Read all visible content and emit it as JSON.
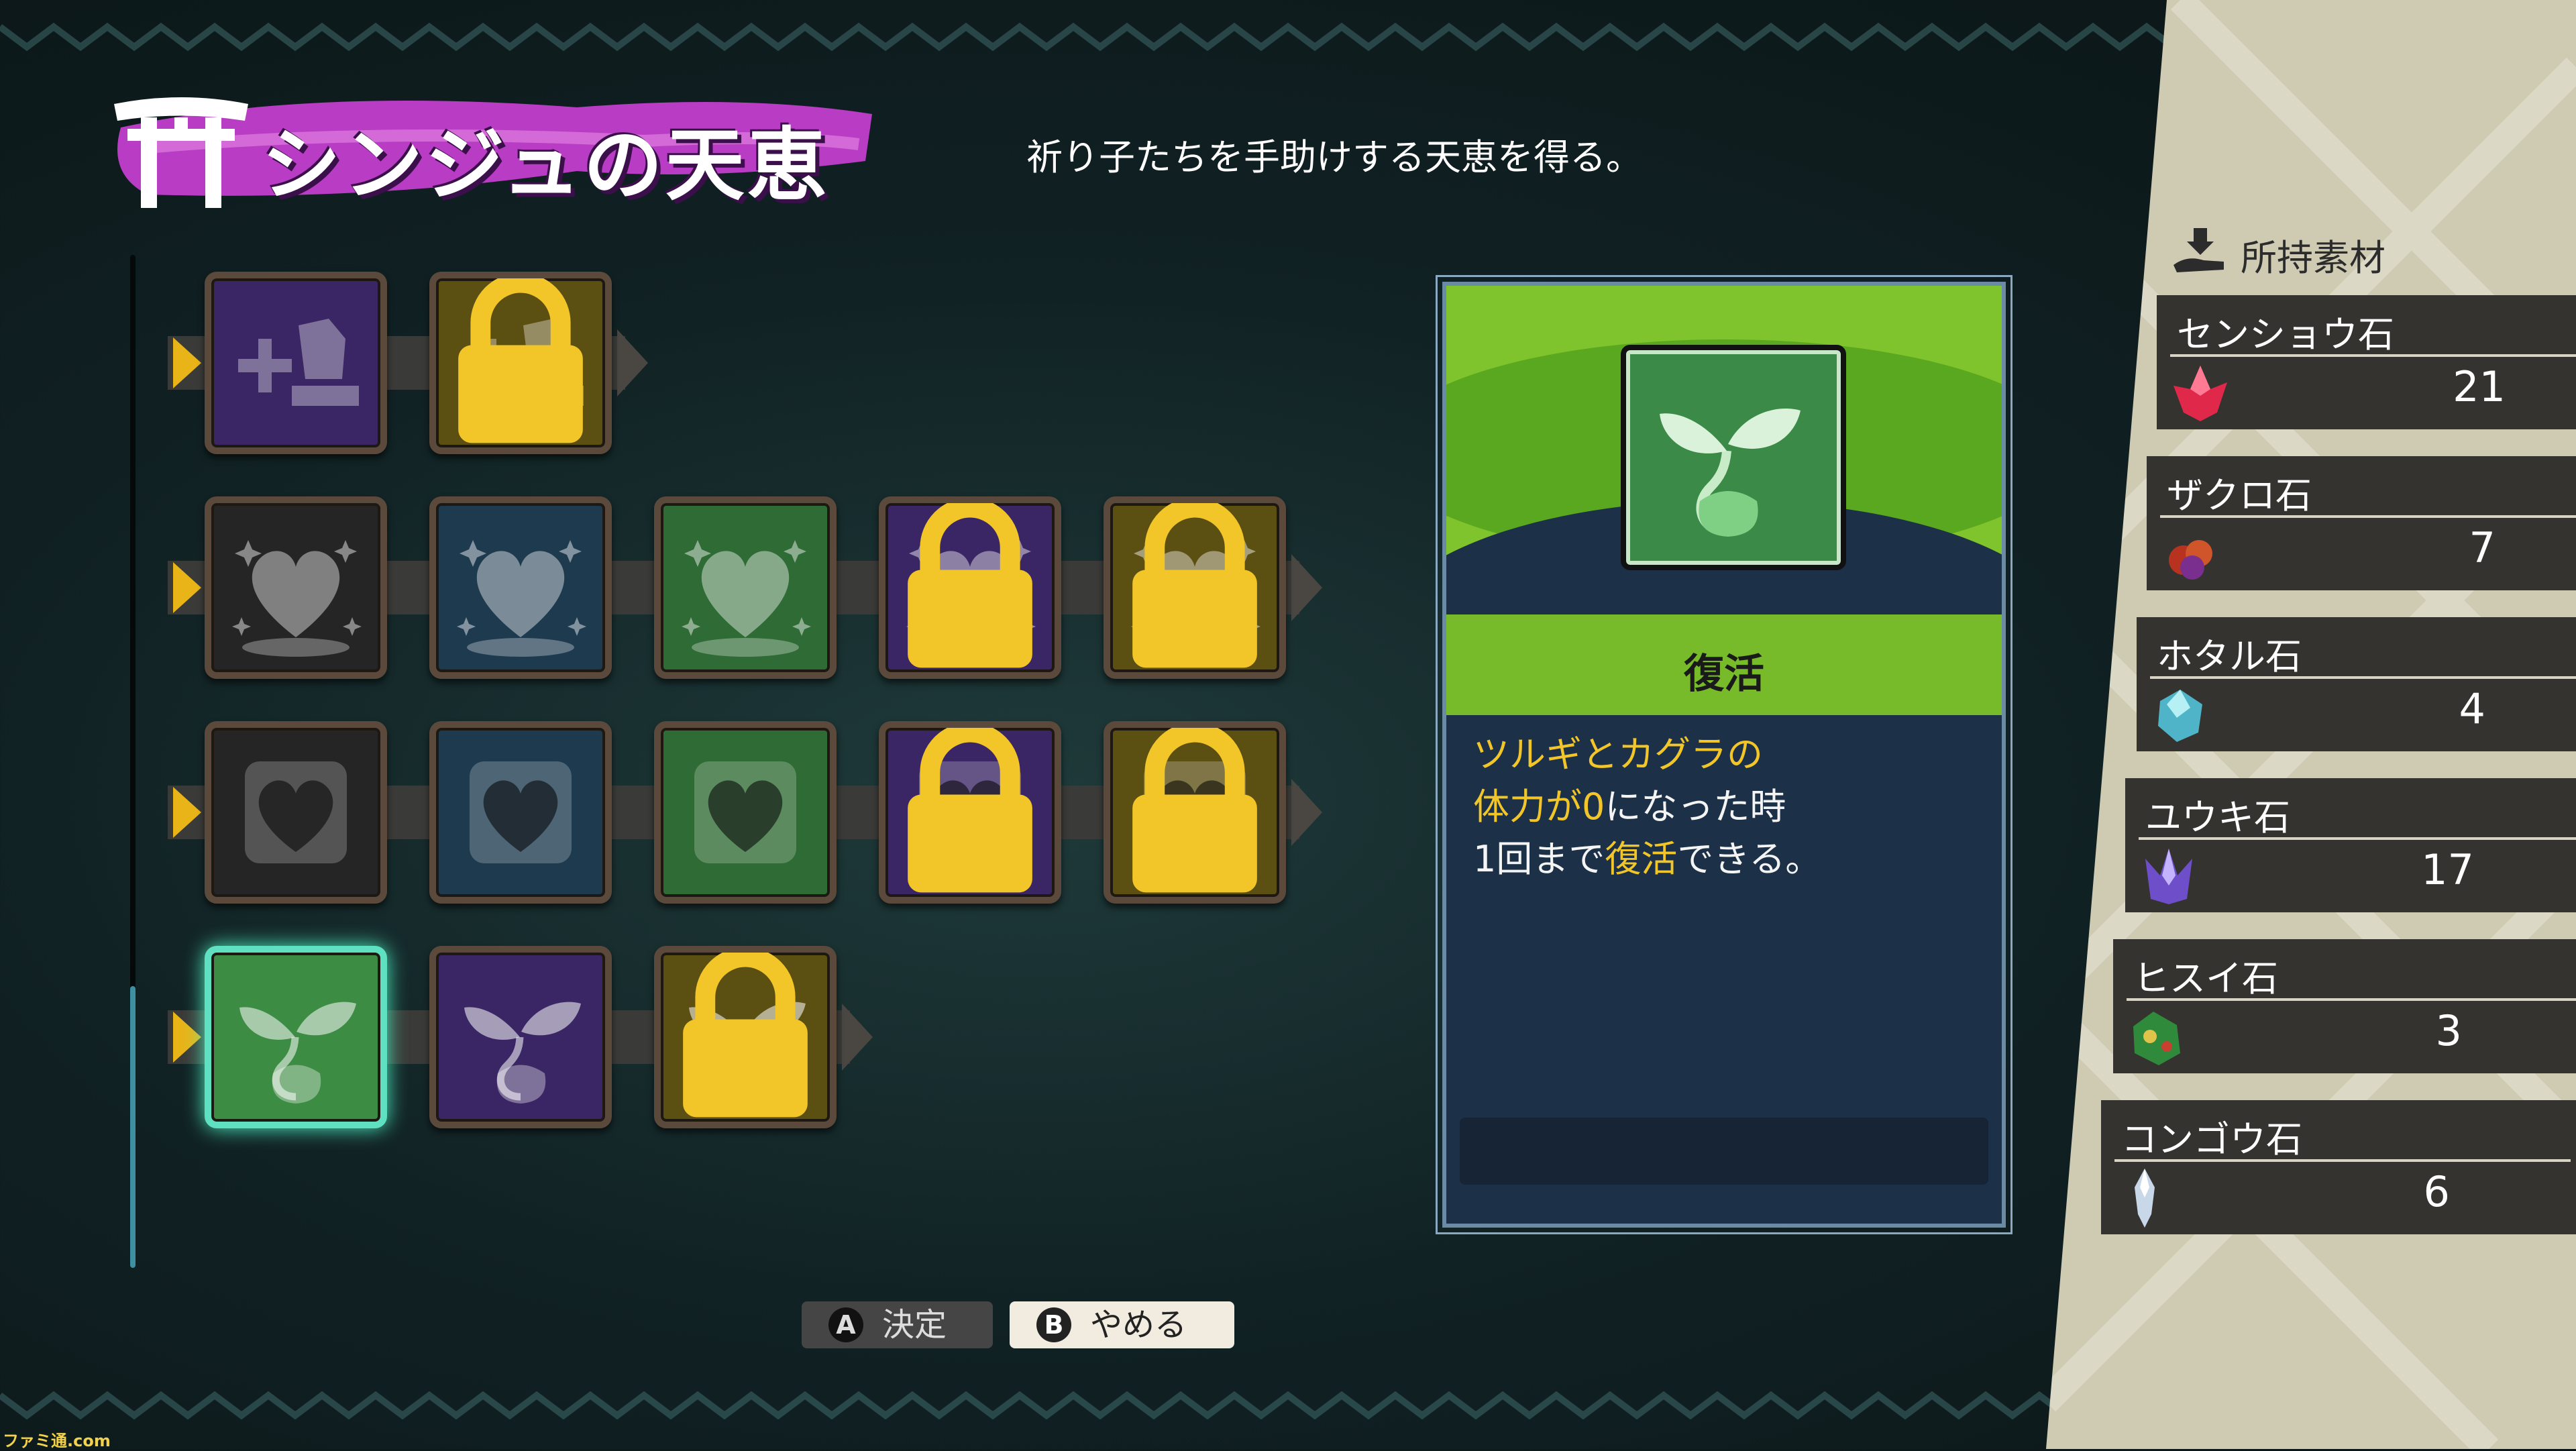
{
  "title": "シンジュの天恵",
  "subtitle": "祈り子たちを手助けする天恵を得る。",
  "skill_grid": {
    "rows": [
      {
        "tiles": [
          {
            "color": "purple",
            "icon": "plus-stone-icon",
            "locked": false
          },
          {
            "color": "gold",
            "icon": "plus-stone-icon",
            "locked": true
          }
        ]
      },
      {
        "tiles": [
          {
            "color": "black",
            "icon": "sparkle-heart-icon",
            "locked": false
          },
          {
            "color": "blue",
            "icon": "sparkle-heart-icon",
            "locked": false
          },
          {
            "color": "green",
            "icon": "sparkle-heart-icon",
            "locked": false
          },
          {
            "color": "purple",
            "icon": "sparkle-heart-icon",
            "locked": true
          },
          {
            "color": "gold",
            "icon": "sparkle-heart-icon",
            "locked": true
          }
        ]
      },
      {
        "tiles": [
          {
            "color": "black",
            "icon": "framed-heart-icon",
            "locked": false
          },
          {
            "color": "blue",
            "icon": "framed-heart-icon",
            "locked": false
          },
          {
            "color": "green",
            "icon": "framed-heart-icon",
            "locked": false
          },
          {
            "color": "purple",
            "icon": "framed-heart-icon",
            "locked": true
          },
          {
            "color": "gold",
            "icon": "framed-heart-icon",
            "locked": true
          }
        ]
      },
      {
        "tiles": [
          {
            "color": "green",
            "icon": "sprout-icon",
            "locked": false,
            "selected": true
          },
          {
            "color": "purple",
            "icon": "sprout-icon",
            "locked": false
          },
          {
            "color": "gold",
            "icon": "sprout-icon",
            "locked": true
          }
        ]
      }
    ]
  },
  "detail": {
    "name": "復活",
    "icon": "sprout-icon",
    "desc_line1": "ツルギとカグラの",
    "desc_line2_hl": "体力が0",
    "desc_line2_rest": "になった時",
    "desc_line3_pre": "1回まで",
    "desc_line3_hl": "復活",
    "desc_line3_post": "できる。",
    "highlight_color": "#f2c529"
  },
  "buttons": {
    "confirm_key": "A",
    "confirm_label": "決定",
    "cancel_key": "B",
    "cancel_label": "やめる"
  },
  "materials": {
    "header": "所持素材",
    "items": [
      {
        "name": "センショウ石",
        "count": "21",
        "icon": "red-crystal-icon"
      },
      {
        "name": "ザクロ石",
        "count": "7",
        "icon": "garnet-icon"
      },
      {
        "name": "ホタル石",
        "count": "4",
        "icon": "fluorite-icon"
      },
      {
        "name": "ユウキ石",
        "count": "17",
        "icon": "purple-crystal-icon"
      },
      {
        "name": "ヒスイ石",
        "count": "3",
        "icon": "jade-icon"
      },
      {
        "name": "コンゴウ石",
        "count": "6",
        "icon": "diamond-icon"
      }
    ]
  },
  "watermark": "ファミ通.com"
}
